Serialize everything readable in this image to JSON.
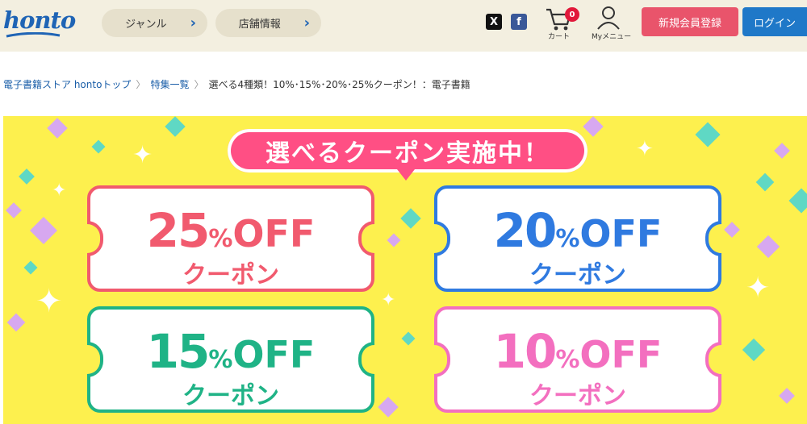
{
  "header": {
    "logo": "honto",
    "nav": [
      {
        "label": "ジャンル"
      },
      {
        "label": "店舗情報"
      }
    ],
    "sns": {
      "x_label": "X",
      "fb_label": "f"
    },
    "cart": {
      "label": "カート",
      "count": "0"
    },
    "mymenu": {
      "label": "Myメニュー"
    },
    "register_label": "新規会員登録",
    "login_label": "ログイン"
  },
  "breadcrumb": {
    "items": [
      "電子書籍ストア hontoトップ",
      "特集一覧"
    ],
    "current": "選べる4種類！10%･15%･20%･25%クーポン！：電子書籍",
    "separator": "〉"
  },
  "banner": {
    "title": "選べるクーポン実施中！",
    "coupons": [
      {
        "number": "25",
        "percent": "%",
        "off": "OFF",
        "label": "クーポン",
        "color": "#f15a6e"
      },
      {
        "number": "20",
        "percent": "%",
        "off": "OFF",
        "label": "クーポン",
        "color": "#2f7ae0"
      },
      {
        "number": "15",
        "percent": "%",
        "off": "OFF",
        "label": "クーポン",
        "color": "#1fb386"
      },
      {
        "number": "10",
        "percent": "%",
        "off": "OFF",
        "label": "クーポン",
        "color": "#f36fbf"
      }
    ],
    "colors": {
      "background": "#fdf04e",
      "title_bg": "#ff4f84"
    }
  }
}
